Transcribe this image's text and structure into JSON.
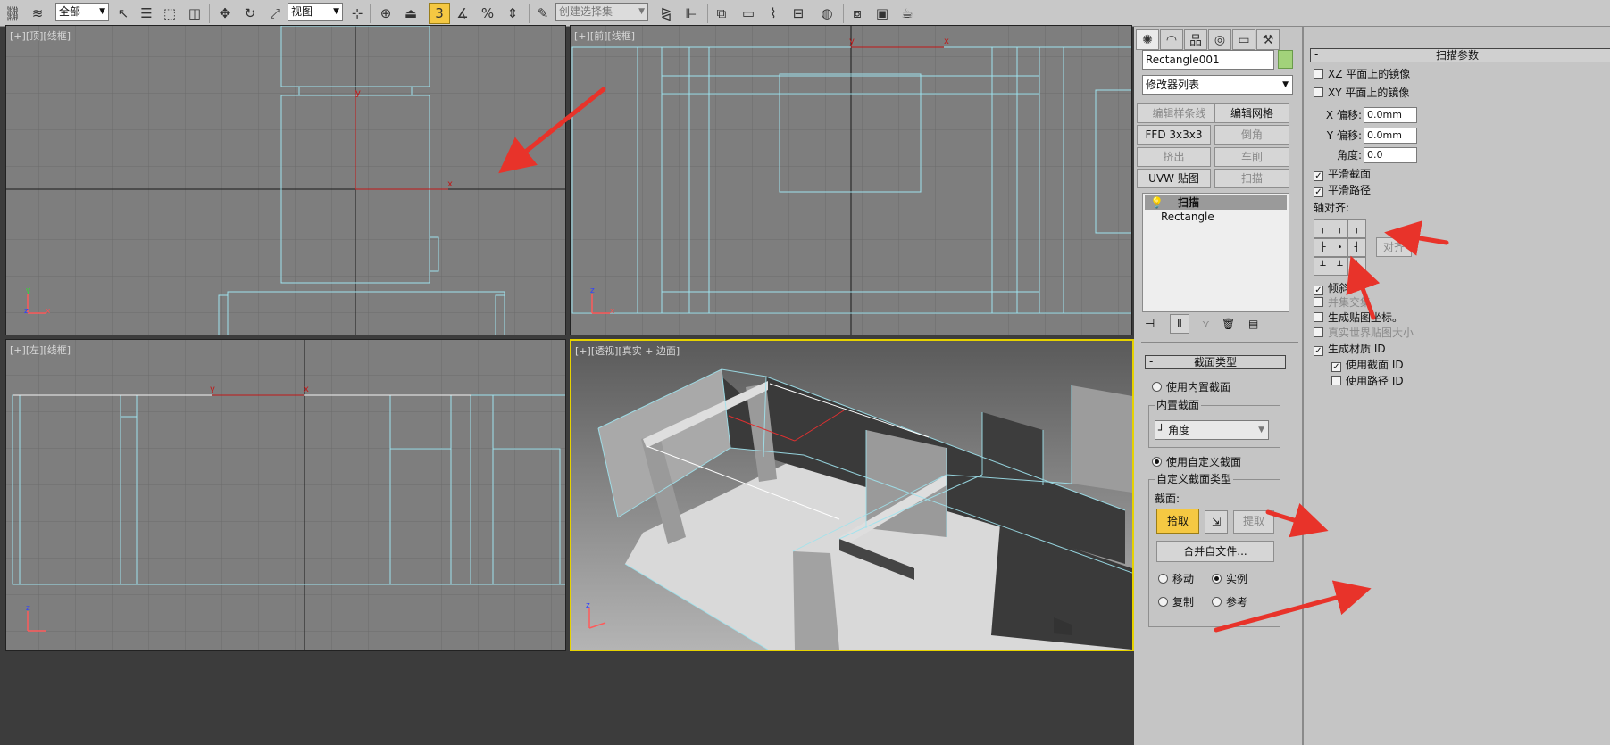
{
  "toolbar": {
    "selection_filter": "全部",
    "ref_coord": "视图",
    "named_selection": "创建选择集"
  },
  "viewports": {
    "top": {
      "label_plus": "[+]",
      "label_view": "[顶]",
      "label_shade": "[线框]"
    },
    "front": {
      "label_plus": "[+]",
      "label_view": "[前]",
      "label_shade": "[线框]"
    },
    "left": {
      "label_plus": "[+]",
      "label_view": "[左]",
      "label_shade": "[线框]"
    },
    "persp": {
      "label_plus": "[+]",
      "label_view": "[透视]",
      "label_shade": "[真实 + 边面]"
    },
    "axis_x": "x",
    "axis_y": "y",
    "axis_z": "z"
  },
  "command_panel": {
    "object_name": "Rectangle001",
    "object_color": "#a2d27a",
    "modifier_list": "修改器列表",
    "modifier_buttons": [
      "编辑样条线",
      "编辑网格",
      "FFD 3x3x3",
      "倒角",
      "挤出",
      "车削",
      "UVW 贴图",
      "扫描"
    ],
    "stack": [
      "扫描",
      "Rectangle"
    ],
    "section_type": {
      "title": "截面类型",
      "builtin_radio": "使用内置截面",
      "builtin_group": "内置截面",
      "builtin_value": "角度",
      "custom_radio": "使用自定义截面",
      "custom_group": "自定义截面类型",
      "section_label": "截面:",
      "pick": "拾取",
      "extract": "提取",
      "merge": "合并自文件...",
      "move": "移动",
      "instance": "实例",
      "copy": "复制",
      "reference": "参考"
    }
  },
  "sweep_params": {
    "title": "扫描参数",
    "mirror_xz": "XZ 平面上的镜像",
    "mirror_xy": "XY 平面上的镜像",
    "x_offset_label": "X 偏移:",
    "x_offset": "0.0mm",
    "y_offset_label": "Y 偏移:",
    "y_offset": "0.0mm",
    "angle_label": "角度:",
    "angle": "0.0",
    "smooth_section": "平滑截面",
    "smooth_path": "平滑路径",
    "pivot_align": "轴对齐:",
    "align_btn": "对齐",
    "banking": "倾斜",
    "union_intersect": "并集交集",
    "gen_map_coords": "生成贴图坐标。",
    "real_world": "真实世界贴图大小",
    "gen_mat_id": "生成材质 ID",
    "use_section_id": "使用截面 ID",
    "use_path_id": "使用路径 ID"
  }
}
